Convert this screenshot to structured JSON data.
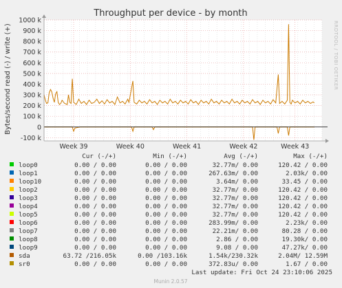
{
  "title": "Throughput per device - by month",
  "side_label": "RRDTOOL / TOBI OETIKER",
  "footer": "Munin 2.0.57",
  "colors": {
    "background": "#f0f0f0",
    "plot_background": "#ffffff",
    "grid_major": "#e8a0a0",
    "grid_minor": "#d8d8d8",
    "zero_line": "#000000",
    "sda_series": "#cc7a00"
  },
  "chart_data": {
    "type": "line",
    "ylabel": "Bytes/second read (-) / write (+)",
    "ylim": [
      -130000,
      1000000
    ],
    "y_ticks": [
      "1000 k",
      "900 k",
      "800 k",
      "700 k",
      "600 k",
      "500 k",
      "400 k",
      "300 k",
      "200 k",
      "100 k",
      "0",
      "-100 k"
    ],
    "y_tick_values": [
      1000000,
      900000,
      800000,
      700000,
      600000,
      500000,
      400000,
      300000,
      200000,
      100000,
      0,
      -100000
    ],
    "x_ticks": [
      "Week 39",
      "Week 40",
      "Week 41",
      "Week 42",
      "Week 43"
    ],
    "x_tick_values": [
      0.115,
      0.335,
      0.555,
      0.775,
      0.975
    ],
    "x_range": [
      0,
      1.08
    ],
    "series": [
      {
        "name": "sda",
        "color": "#cc7a00",
        "write": [
          [
            0.0,
            300000
          ],
          [
            0.005,
            250000
          ],
          [
            0.01,
            220000
          ],
          [
            0.015,
            225000
          ],
          [
            0.02,
            320000
          ],
          [
            0.025,
            350000
          ],
          [
            0.03,
            330000
          ],
          [
            0.035,
            270000
          ],
          [
            0.04,
            230000
          ],
          [
            0.045,
            310000
          ],
          [
            0.05,
            330000
          ],
          [
            0.055,
            230000
          ],
          [
            0.06,
            210000
          ],
          [
            0.065,
            220000
          ],
          [
            0.07,
            250000
          ],
          [
            0.08,
            220000
          ],
          [
            0.09,
            210000
          ],
          [
            0.095,
            300000
          ],
          [
            0.1,
            230000
          ],
          [
            0.105,
            220000
          ],
          [
            0.11,
            450000
          ],
          [
            0.115,
            230000
          ],
          [
            0.125,
            210000
          ],
          [
            0.135,
            260000
          ],
          [
            0.145,
            220000
          ],
          [
            0.155,
            240000
          ],
          [
            0.165,
            210000
          ],
          [
            0.175,
            250000
          ],
          [
            0.185,
            220000
          ],
          [
            0.195,
            230000
          ],
          [
            0.205,
            260000
          ],
          [
            0.215,
            220000
          ],
          [
            0.225,
            245000
          ],
          [
            0.235,
            215000
          ],
          [
            0.245,
            255000
          ],
          [
            0.255,
            225000
          ],
          [
            0.265,
            240000
          ],
          [
            0.275,
            210000
          ],
          [
            0.285,
            280000
          ],
          [
            0.295,
            225000
          ],
          [
            0.305,
            240000
          ],
          [
            0.315,
            215000
          ],
          [
            0.325,
            260000
          ],
          [
            0.33,
            230000
          ],
          [
            0.345,
            430000
          ],
          [
            0.35,
            230000
          ],
          [
            0.36,
            215000
          ],
          [
            0.37,
            250000
          ],
          [
            0.38,
            225000
          ],
          [
            0.39,
            240000
          ],
          [
            0.4,
            215000
          ],
          [
            0.41,
            255000
          ],
          [
            0.42,
            225000
          ],
          [
            0.43,
            240000
          ],
          [
            0.44,
            210000
          ],
          [
            0.45,
            250000
          ],
          [
            0.46,
            225000
          ],
          [
            0.47,
            240000
          ],
          [
            0.48,
            215000
          ],
          [
            0.49,
            260000
          ],
          [
            0.5,
            225000
          ],
          [
            0.51,
            240000
          ],
          [
            0.52,
            215000
          ],
          [
            0.53,
            250000
          ],
          [
            0.54,
            225000
          ],
          [
            0.55,
            240000
          ],
          [
            0.56,
            215000
          ],
          [
            0.57,
            255000
          ],
          [
            0.58,
            225000
          ],
          [
            0.59,
            240000
          ],
          [
            0.6,
            210000
          ],
          [
            0.61,
            250000
          ],
          [
            0.62,
            225000
          ],
          [
            0.63,
            240000
          ],
          [
            0.64,
            215000
          ],
          [
            0.65,
            260000
          ],
          [
            0.66,
            225000
          ],
          [
            0.67,
            240000
          ],
          [
            0.68,
            215000
          ],
          [
            0.69,
            250000
          ],
          [
            0.7,
            225000
          ],
          [
            0.71,
            240000
          ],
          [
            0.72,
            215000
          ],
          [
            0.73,
            260000
          ],
          [
            0.74,
            225000
          ],
          [
            0.75,
            240000
          ],
          [
            0.76,
            215000
          ],
          [
            0.77,
            250000
          ],
          [
            0.78,
            225000
          ],
          [
            0.79,
            240000
          ],
          [
            0.8,
            215000
          ],
          [
            0.81,
            255000
          ],
          [
            0.82,
            225000
          ],
          [
            0.83,
            240000
          ],
          [
            0.84,
            210000
          ],
          [
            0.85,
            250000
          ],
          [
            0.86,
            225000
          ],
          [
            0.87,
            240000
          ],
          [
            0.88,
            215000
          ],
          [
            0.89,
            255000
          ],
          [
            0.9,
            225000
          ],
          [
            0.91,
            490000
          ],
          [
            0.915,
            220000
          ],
          [
            0.925,
            240000
          ],
          [
            0.935,
            215000
          ],
          [
            0.945,
            250000
          ],
          [
            0.95,
            960000
          ],
          [
            0.955,
            230000
          ],
          [
            0.96,
            215000
          ],
          [
            0.965,
            250000
          ],
          [
            0.975,
            225000
          ],
          [
            0.985,
            240000
          ],
          [
            0.995,
            215000
          ],
          [
            1.005,
            250000
          ],
          [
            1.015,
            225000
          ],
          [
            1.025,
            240000
          ],
          [
            1.035,
            220000
          ],
          [
            1.045,
            235000
          ],
          [
            1.05,
            225000
          ]
        ],
        "read": [
          [
            0.0,
            0
          ],
          [
            0.11,
            0
          ],
          [
            0.115,
            -40000
          ],
          [
            0.12,
            -10000
          ],
          [
            0.13,
            -5000
          ],
          [
            0.14,
            0
          ],
          [
            0.34,
            0
          ],
          [
            0.345,
            -40000
          ],
          [
            0.35,
            0
          ],
          [
            0.42,
            0
          ],
          [
            0.425,
            -25000
          ],
          [
            0.43,
            0
          ],
          [
            0.81,
            0
          ],
          [
            0.815,
            -120000
          ],
          [
            0.82,
            0
          ],
          [
            0.905,
            0
          ],
          [
            0.91,
            -60000
          ],
          [
            0.915,
            0
          ],
          [
            0.945,
            0
          ],
          [
            0.95,
            -80000
          ],
          [
            0.955,
            0
          ],
          [
            1.05,
            0
          ]
        ]
      }
    ]
  },
  "legend": {
    "headers": [
      "Cur (-/+)",
      "Min (-/+)",
      "Avg (-/+)",
      "Max (-/+)"
    ],
    "rows": [
      {
        "name": "loop0",
        "color": "#00cc00",
        "cur": "0.00 /  0.00",
        "min": "0.00 /  0.00",
        "avg": "32.77m/  0.00",
        "max": "120.42 /  0.00"
      },
      {
        "name": "loop1",
        "color": "#0066b3",
        "cur": "0.00 /  0.00",
        "min": "0.00 /  0.00",
        "avg": "267.63m/  0.00",
        "max": "2.03k/  0.00"
      },
      {
        "name": "loop10",
        "color": "#ff8000",
        "cur": "0.00 /  0.00",
        "min": "0.00 /  0.00",
        "avg": "3.64m/  0.00",
        "max": "33.45 /  0.00"
      },
      {
        "name": "loop2",
        "color": "#ffcc00",
        "cur": "0.00 /  0.00",
        "min": "0.00 /  0.00",
        "avg": "32.77m/  0.00",
        "max": "120.42 /  0.00"
      },
      {
        "name": "loop3",
        "color": "#330099",
        "cur": "0.00 /  0.00",
        "min": "0.00 /  0.00",
        "avg": "32.77m/  0.00",
        "max": "120.42 /  0.00"
      },
      {
        "name": "loop4",
        "color": "#990099",
        "cur": "0.00 /  0.00",
        "min": "0.00 /  0.00",
        "avg": "32.77m/  0.00",
        "max": "120.42 /  0.00"
      },
      {
        "name": "loop5",
        "color": "#ccff00",
        "cur": "0.00 /  0.00",
        "min": "0.00 /  0.00",
        "avg": "32.77m/  0.00",
        "max": "120.42 /  0.00"
      },
      {
        "name": "loop6",
        "color": "#ff0000",
        "cur": "0.00 /  0.00",
        "min": "0.00 /  0.00",
        "avg": "283.99m/  0.00",
        "max": "2.23k/  0.00"
      },
      {
        "name": "loop7",
        "color": "#808080",
        "cur": "0.00 /  0.00",
        "min": "0.00 /  0.00",
        "avg": "22.21m/  0.00",
        "max": "80.28 /  0.00"
      },
      {
        "name": "loop8",
        "color": "#008f00",
        "cur": "0.00 /  0.00",
        "min": "0.00 /  0.00",
        "avg": "2.86 /  0.00",
        "max": "19.30k/  0.00"
      },
      {
        "name": "loop9",
        "color": "#00487d",
        "cur": "0.00 /  0.00",
        "min": "0.00 /  0.00",
        "avg": "9.08 /  0.00",
        "max": "47.27k/  0.00"
      },
      {
        "name": "sda",
        "color": "#b35a00",
        "cur": "63.72 /216.05k",
        "min": "0.00 /103.16k",
        "avg": "1.54k/230.32k",
        "max": "2.04M/ 12.59M"
      },
      {
        "name": "sr0",
        "color": "#b38f00",
        "cur": "0.00 /  0.00",
        "min": "0.00 /  0.00",
        "avg": "372.83u/  0.00",
        "max": "1.67 /  0.00"
      }
    ],
    "last_update": "Last update: Fri Oct 24 23:10:06 2025"
  }
}
